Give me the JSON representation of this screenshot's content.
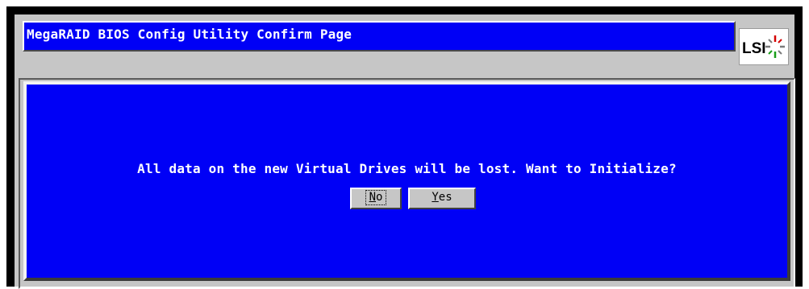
{
  "window": {
    "title": "MegaRAID BIOS Config Utility Confirm Page"
  },
  "logo": {
    "text": "LSI",
    "icon": "lsi-logo-icon",
    "colors": {
      "text": "#000000",
      "red": "#d40000",
      "green": "#1a9e1a",
      "gray": "#7a7a7a"
    }
  },
  "dialog": {
    "message": "All data on the new Virtual Drives will be lost. Want to Initialize?",
    "buttons": {
      "no": {
        "hotkey": "N",
        "rest": "o",
        "focused": true
      },
      "yes": {
        "hotkey": "Y",
        "rest": "es",
        "focused": false
      }
    }
  },
  "colors": {
    "panel_blue": "#0000f6",
    "chrome_gray": "#c6c6c6",
    "border_black": "#000000"
  }
}
